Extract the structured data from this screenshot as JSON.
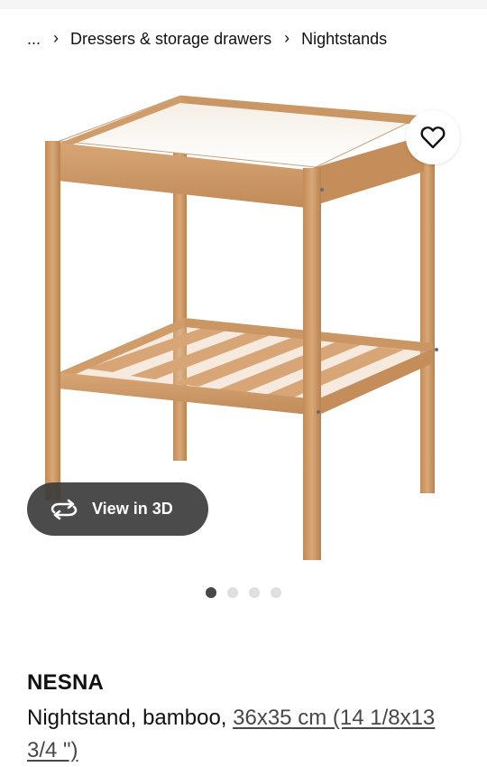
{
  "breadcrumb": {
    "ellipsis": "...",
    "separator": "›",
    "items": [
      {
        "label": "Dressers & storage drawers"
      },
      {
        "label": "Nightstands"
      }
    ]
  },
  "media": {
    "view_3d_label": "View in 3D",
    "image_count": 4,
    "active_index": 0
  },
  "product": {
    "name": "NESNA",
    "description": "Nightstand, bamboo, ",
    "size_link": "36x35 cm (14 1/8x13 3/4 \")"
  },
  "icons": {
    "favorite": "heart-outline-icon",
    "view_3d": "rotate-arrows-icon"
  }
}
